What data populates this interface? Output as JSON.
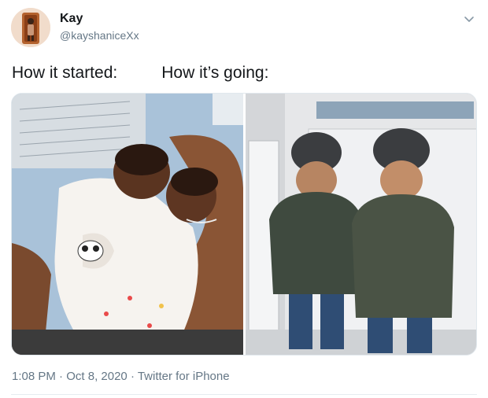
{
  "user": {
    "display_name": "Kay",
    "handle": "@kayshaniceXx"
  },
  "tweet": {
    "text_left": "How it started:",
    "text_right": "How it’s going:"
  },
  "meta": {
    "time": "1:08 PM",
    "separator": " · ",
    "date": "Oct 8, 2020",
    "source": "Twitter for iPhone"
  },
  "icons": {
    "menu": "chevron-down-icon"
  },
  "colors": {
    "primary_text": "#14171a",
    "secondary_text": "#657786",
    "border": "#e1e8ed"
  }
}
